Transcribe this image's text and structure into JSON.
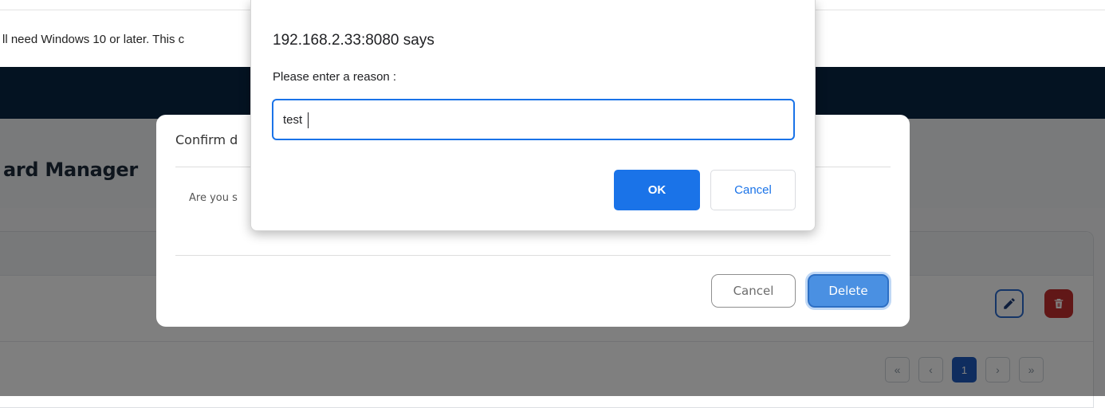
{
  "infobar": {
    "message": "ll need Windows 10 or later. This c"
  },
  "page": {
    "title": "ard Manager"
  },
  "pagination": {
    "first": "«",
    "prev": "‹",
    "current": "1",
    "next": "›",
    "last": "»"
  },
  "confirm_modal": {
    "title": "Confirm d",
    "body": "Are you s",
    "cancel_label": "Cancel",
    "delete_label": "Delete"
  },
  "prompt": {
    "origin": "192.168.2.33:8080 says",
    "message": "Please enter a reason :",
    "input_value": "test",
    "ok_label": "OK",
    "cancel_label": "Cancel"
  },
  "icons": {
    "edit": "pencil-icon",
    "delete": "trash-icon"
  },
  "colors": {
    "navbar": "#082744",
    "edit_button": "#2a6bcf",
    "delete_icon_button": "#c22f2f",
    "modal_delete_button": "#4a90e2",
    "prompt_ok": "#1a73e8",
    "pagination_active": "#1f5bbf"
  }
}
